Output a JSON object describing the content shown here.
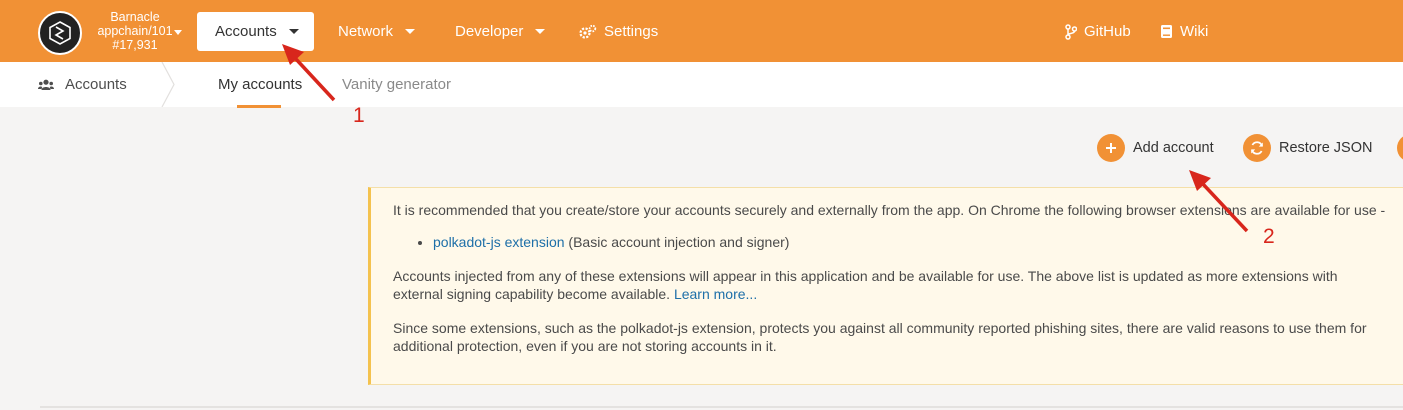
{
  "header": {
    "chain_name": "Barnacle",
    "chain_id": "appchain/101",
    "block_number": "#17,931",
    "nav": {
      "accounts": "Accounts",
      "network": "Network",
      "developer": "Developer",
      "settings": "Settings",
      "github": "GitHub",
      "wiki": "Wiki"
    }
  },
  "subnav": {
    "section": "Accounts",
    "tabs": [
      "My accounts",
      "Vanity generator"
    ]
  },
  "actions": {
    "add_account": "Add account",
    "restore_json": "Restore JSON"
  },
  "info": {
    "para1": "It is recommended that you create/store your accounts securely and externally from the app. On Chrome the following browser extensions are available for use -",
    "extension_link": "polkadot-js extension",
    "extension_desc": " (Basic account injection and signer)",
    "para2": "Accounts injected from any of these extensions will appear in this application and be available for use. The above list is updated as more extensions with external signing capability become available. ",
    "learn_more": "Learn more...",
    "para3": "Since some extensions, such as the polkadot-js extension, protects you against all community reported phishing sites, there are valid reasons to use them for additional protection, even if you are not storing accounts in it."
  },
  "annotations": {
    "label_1": "1",
    "label_2": "2",
    "color": "#d8261c"
  },
  "colors": {
    "brand": "#f19135",
    "info_bg": "#fff9ea",
    "info_border": "#f4c24e",
    "link": "#1e6fa8"
  }
}
